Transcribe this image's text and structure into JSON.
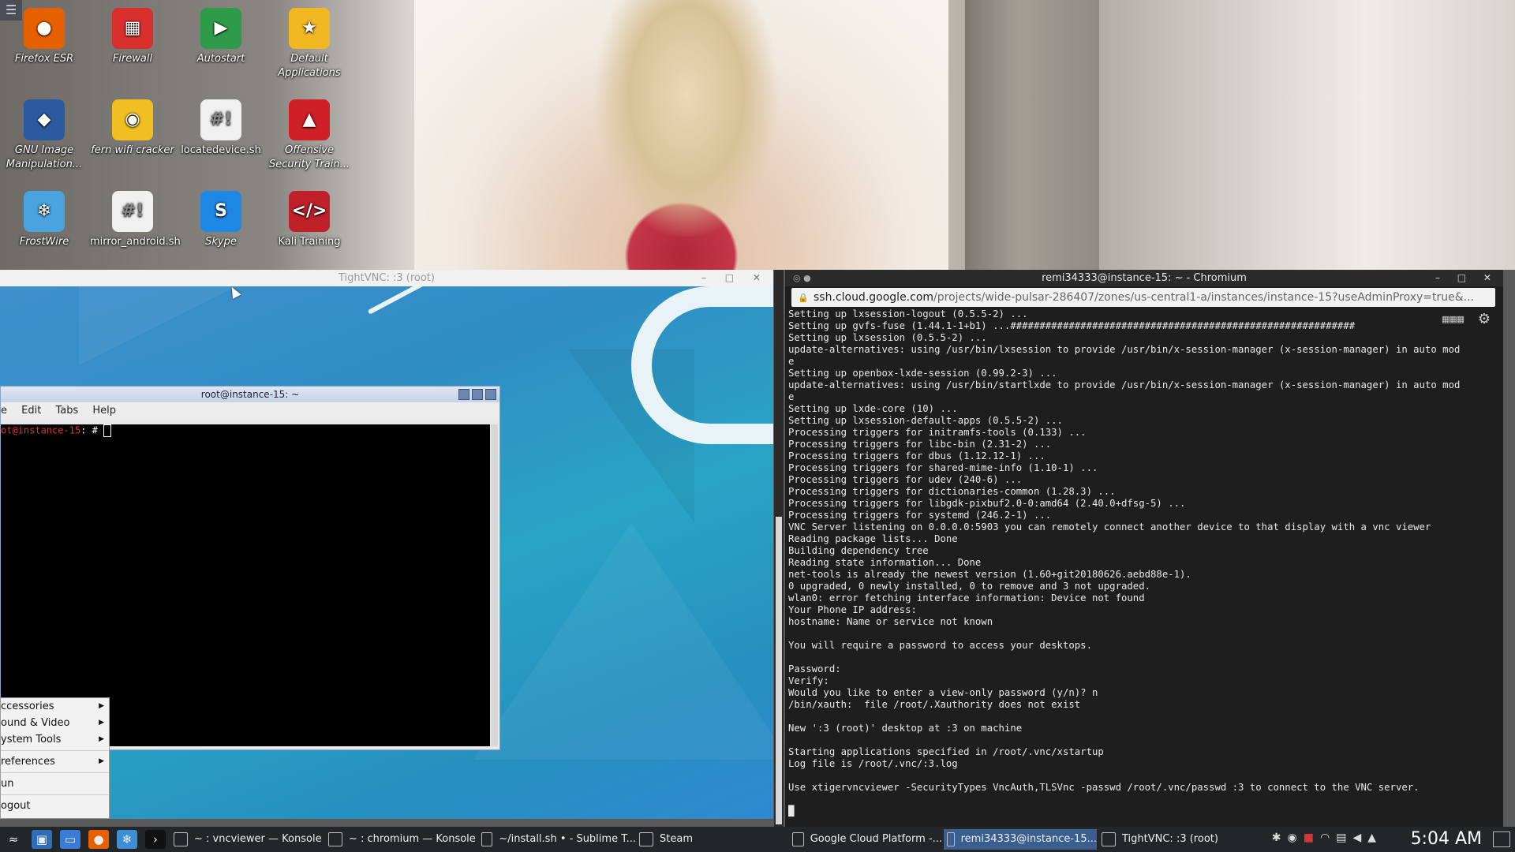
{
  "desktop": {
    "menu_icon": "hamburger-icon",
    "icons": [
      {
        "label": "Firefox ESR",
        "icon": "firefox-icon",
        "color": "#e66000",
        "glyph": "●"
      },
      {
        "label": "Firewall",
        "icon": "firewall-icon",
        "color": "#d9302e",
        "glyph": "▦"
      },
      {
        "label": "Autostart",
        "icon": "autostart-icon",
        "color": "#2e9b4a",
        "glyph": "▶"
      },
      {
        "label": "Default Applications",
        "icon": "star-icon",
        "color": "#f2b824",
        "glyph": "★"
      },
      {
        "label": "GNU Image Manipulation...",
        "icon": "gimp-icon",
        "color": "#2c5aa0",
        "glyph": "◆"
      },
      {
        "label": "fern wifi cracker",
        "icon": "wifi-tower-icon",
        "color": "#f0c020",
        "glyph": "◉"
      },
      {
        "label": "locatedevice.sh",
        "icon": "script-file-icon",
        "color": "#f0f0f0",
        "glyph": "#!"
      },
      {
        "label": "Offensive Security Train...",
        "icon": "offsec-icon",
        "color": "#cf2027",
        "glyph": "▲"
      },
      {
        "label": "FrostWire",
        "icon": "frostwire-icon",
        "color": "#4aa3df",
        "glyph": "❄"
      },
      {
        "label": "mirror_android.sh",
        "icon": "script-file-icon",
        "color": "#f0f0f0",
        "glyph": "#!"
      },
      {
        "label": "Skype",
        "icon": "skype-icon",
        "color": "#1e88e5",
        "glyph": "S"
      },
      {
        "label": "Kali Training",
        "icon": "kali-training-icon",
        "color": "#c0202a",
        "glyph": "</>"
      }
    ]
  },
  "vnc": {
    "title": "TightVNC: :3 (root)",
    "controls": "– □ ✕"
  },
  "konsole": {
    "title": "root@instance-15: ~",
    "menu": [
      "e",
      "Edit",
      "Tabs",
      "Help"
    ],
    "prompt_user": "ot@instance-15",
    "prompt_rest": ": # "
  },
  "app_menu": {
    "items": [
      "ccessories",
      "ound & Video",
      "ystem Tools"
    ],
    "prefs": "references",
    "run": "un",
    "logout": "ogout"
  },
  "chromium": {
    "title": "remi34333@instance-15: ~ - Chromium",
    "controls": "– □ ✕",
    "url_host": "ssh.cloud.google.com",
    "url_path": "/projects/wide-pulsar-286407/zones/us-central1-a/instances/instance-15?useAdminProxy=true&...",
    "terminal_lines": [
      "Setting up lxsession-logout (0.5.5-2) ...",
      "Setting up gvfs-fuse (1.44.1-1+b1) ...###########################################################",
      "Setting up lxsession (0.5.5-2) ...",
      "update-alternatives: using /usr/bin/lxsession to provide /usr/bin/x-session-manager (x-session-manager) in auto mod",
      "e",
      "Setting up openbox-lxde-session (0.99.2-3) ...",
      "update-alternatives: using /usr/bin/startlxde to provide /usr/bin/x-session-manager (x-session-manager) in auto mod",
      "e",
      "Setting up lxde-core (10) ...",
      "Setting up lxsession-default-apps (0.5.5-2) ...",
      "Processing triggers for initramfs-tools (0.133) ...",
      "Processing triggers for libc-bin (2.31-2) ...",
      "Processing triggers for dbus (1.12.12-1) ...",
      "Processing triggers for shared-mime-info (1.10-1) ...",
      "Processing triggers for udev (240-6) ...",
      "Processing triggers for dictionaries-common (1.28.3) ...",
      "Processing triggers for libgdk-pixbuf2.0-0:amd64 (2.40.0+dfsg-5) ...",
      "Processing triggers for systemd (246.2-1) ...",
      "VNC Server listening on 0.0.0.0:5903 you can remotely connect another device to that display with a vnc viewer",
      "Reading package lists... Done",
      "Building dependency tree",
      "Reading state information... Done",
      "net-tools is already the newest version (1.60+git20180626.aebd88e-1).",
      "0 upgraded, 0 newly installed, 0 to remove and 3 not upgraded.",
      "wlan0: error fetching interface information: Device not found",
      "Your Phone IP address:",
      "hostname: Name or service not known",
      "",
      "You will require a password to access your desktops.",
      "",
      "Password:",
      "Verify:",
      "Would you like to enter a view-only password (y/n)? n",
      "/bin/xauth:  file /root/.Xauthority does not exist",
      "",
      "New ':3 (root)' desktop at :3 on machine",
      "",
      "Starting applications specified in /root/.vnc/xstartup",
      "Log file is /root/.vnc/:3.log",
      "",
      "Use xtigervncviewer -SecurityTypes VncAuth,TLSVnc -passwd /root/.vnc/passwd :3 to connect to the VNC server.",
      "",
      "█"
    ]
  },
  "taskbar": {
    "launchers": [
      {
        "name": "kali-menu-icon",
        "glyph": "≈",
        "color": "#232629"
      },
      {
        "name": "show-desktop-icon",
        "glyph": "▣",
        "color": "#2d6fb5"
      },
      {
        "name": "file-manager-icon",
        "glyph": "▭",
        "color": "#3a7bd5"
      },
      {
        "name": "firefox-icon",
        "glyph": "●",
        "color": "#e66000"
      },
      {
        "name": "frostwire-icon",
        "glyph": "❄",
        "color": "#3e8ed6"
      },
      {
        "name": "terminal-icon",
        "glyph": "›",
        "color": "#111111"
      }
    ],
    "tasks": [
      {
        "label": "~ : vncviewer — Konsole",
        "icon": "konsole-icon",
        "active": false
      },
      {
        "label": "~ : chromium — Konsole",
        "icon": "konsole-icon",
        "active": false
      },
      {
        "label": "~/install.sh • - Sublime T...",
        "icon": "sublime-icon",
        "active": false
      },
      {
        "label": "Steam",
        "icon": "steam-icon",
        "active": false
      },
      {
        "label": "Google Cloud Platform -...",
        "icon": "chromium-icon",
        "active": false
      },
      {
        "label": "remi34333@instance-15...",
        "icon": "chromium-icon",
        "active": true
      },
      {
        "label": "TightVNC: :3 (root)",
        "icon": "tightvnc-icon",
        "active": false
      }
    ],
    "tray_icons": [
      "bluetooth-icon",
      "chrome-icon",
      "package-icon",
      "wifi-icon",
      "clipboard-icon",
      "volume-icon",
      "chevron-up-icon"
    ],
    "clock": "5:04 AM"
  }
}
